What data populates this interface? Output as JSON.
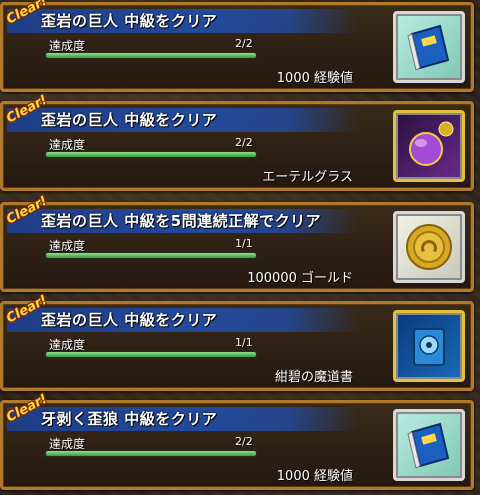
{
  "clear_label": "Clear!",
  "progress_label": "達成度",
  "missions": [
    {
      "title": "歪岩の巨人 中級をクリア",
      "progress_text": "2/2",
      "progress": 1.0,
      "reward": "1000 経験値",
      "icon": "exp-book-icon"
    },
    {
      "title": "歪岩の巨人 中級をクリア",
      "progress_text": "2/2",
      "progress": 1.0,
      "reward": "エーテルグラス",
      "icon": "ether-glass-icon"
    },
    {
      "title": "歪岩の巨人 中級を5問連続正解でクリア",
      "progress_text": "1/1",
      "progress": 1.0,
      "reward": "100000 ゴールド",
      "icon": "gold-coin-icon"
    },
    {
      "title": "歪岩の巨人 中級をクリア",
      "progress_text": "1/1",
      "progress": 1.0,
      "reward": "紺碧の魔道書",
      "icon": "azure-grimoire-icon"
    },
    {
      "title": "牙剥く歪狼 中級をクリア",
      "progress_text": "2/2",
      "progress": 1.0,
      "reward": "1000 経験値",
      "icon": "exp-book-icon"
    }
  ],
  "colors": {
    "accent_blue": "#234a9c",
    "frame_gold": "#b07a2a",
    "clear_yellow": "#ffd84a",
    "bar_green": "#5cc05c"
  }
}
